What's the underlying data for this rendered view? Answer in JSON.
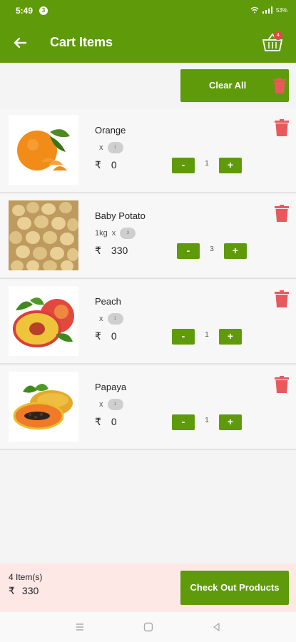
{
  "status": {
    "time": "5:49",
    "notif": "3",
    "battery": "53%"
  },
  "header": {
    "title": "Cart Items",
    "cart_badge": "4"
  },
  "toolbar": {
    "clear_all_label": "Clear All"
  },
  "items": [
    {
      "name": "Orange",
      "unit": "",
      "unit_sep": "x",
      "unit_pill": "1",
      "currency": "₹",
      "price": "0",
      "qty": "1",
      "minus": "-",
      "plus": "+"
    },
    {
      "name": "Baby Potato",
      "unit": "1kg",
      "unit_sep": "x",
      "unit_pill": "3",
      "currency": "₹",
      "price": "330",
      "qty": "3",
      "minus": "-",
      "plus": "+"
    },
    {
      "name": "Peach",
      "unit": "",
      "unit_sep": "x",
      "unit_pill": "1",
      "currency": "₹",
      "price": "0",
      "qty": "1",
      "minus": "-",
      "plus": "+"
    },
    {
      "name": "Papaya",
      "unit": "",
      "unit_sep": "x",
      "unit_pill": "1",
      "currency": "₹",
      "price": "0",
      "qty": "1",
      "minus": "-",
      "plus": "+"
    }
  ],
  "footer": {
    "count_label": "4 Item(s)",
    "currency": "₹",
    "total": "330",
    "checkout_label": "Check Out Products"
  },
  "colors": {
    "brand": "#5f9a0a",
    "delete": "#e8595e",
    "footer_bg": "#fde8e6"
  },
  "icons": [
    "back-arrow-icon",
    "basket-icon",
    "trash-icon",
    "menu-nav-icon",
    "home-nav-icon",
    "back-nav-icon"
  ]
}
